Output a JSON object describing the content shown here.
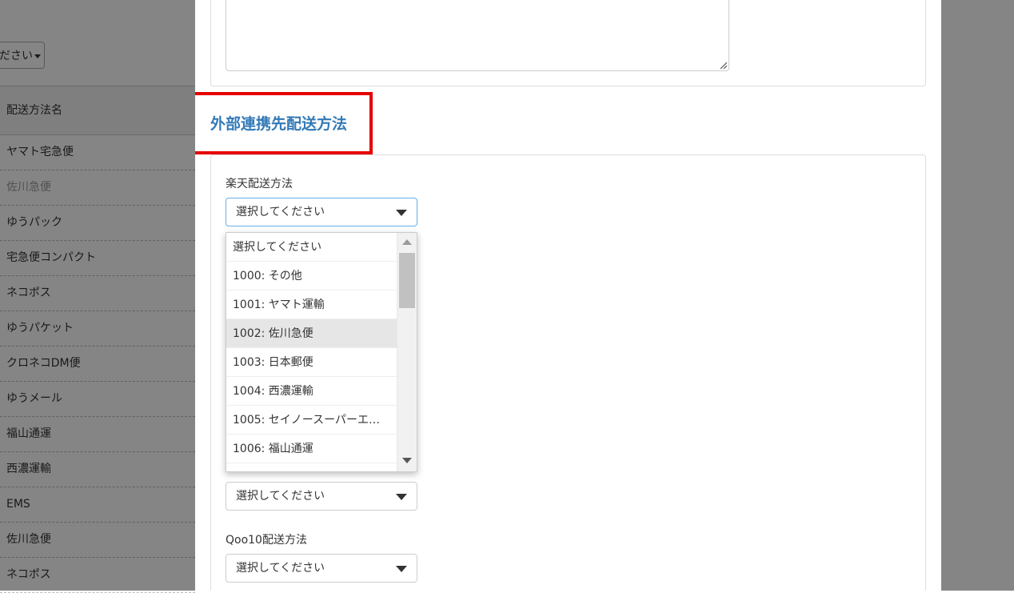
{
  "background": {
    "select_label": "ださい",
    "table_header": "配送方法名",
    "rows": [
      {
        "label": "ヤマト宅急便",
        "muted": false
      },
      {
        "label": "佐川急便",
        "muted": true
      },
      {
        "label": "ゆうパック",
        "muted": false
      },
      {
        "label": "宅急便コンパクト",
        "muted": false
      },
      {
        "label": "ネコポス",
        "muted": false
      },
      {
        "label": "ゆうパケット",
        "muted": false
      },
      {
        "label": "クロネコDM便",
        "muted": false
      },
      {
        "label": "ゆうメール",
        "muted": false
      },
      {
        "label": "福山通運",
        "muted": false
      },
      {
        "label": "西濃運輸",
        "muted": false
      },
      {
        "label": "EMS",
        "muted": false
      },
      {
        "label": "佐川急便",
        "muted": false
      },
      {
        "label": "ネコポス",
        "muted": false
      }
    ]
  },
  "modal": {
    "section_title": "外部連携先配送方法",
    "highlight_color": "#e60000",
    "title_color": "#337ab7",
    "rakuten": {
      "label": "楽天配送方法",
      "selected": "選択してください"
    },
    "dropdown": {
      "options": [
        "選択してください",
        "1000: その他",
        "1001: ヤマト運輸",
        "1002: 佐川急便",
        "1003: 日本郵便",
        "1004: 西濃運輸",
        "1005: セイノースーパーエ…",
        "1006: 福山通運"
      ],
      "hovered_index": 3
    },
    "partial_field": {
      "selected": "選択してください"
    },
    "qoo10": {
      "label": "Qoo10配送方法",
      "selected": "選択してください"
    }
  }
}
